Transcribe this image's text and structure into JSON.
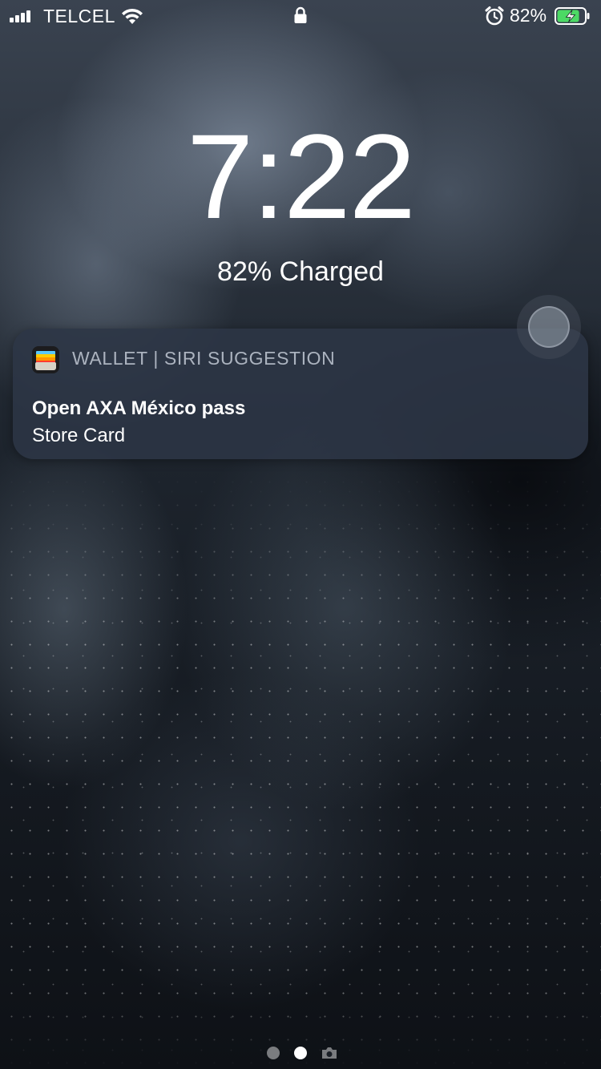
{
  "status_bar": {
    "carrier": "TELCEL",
    "battery_percent": "82%",
    "battery_level": 0.82,
    "charging": true,
    "icons": [
      "signal-icon",
      "wifi-icon",
      "lock-icon",
      "alarm-icon",
      "battery-icon"
    ]
  },
  "lock_screen": {
    "time": "7:22",
    "charge_status": "82% Charged"
  },
  "notification": {
    "app_icon": "wallet-icon",
    "header": "WALLET | SIRI SUGGESTION",
    "title": "Open AXA México pass",
    "body": "Store Card"
  },
  "page_indicator": {
    "pages": 3,
    "active_index": 1,
    "last_page_icon": "camera-icon"
  },
  "colors": {
    "notification_bg": "#2c3646",
    "battery_fill": "#4cd964",
    "text_primary": "#ffffff",
    "text_secondary": "#d7dee8"
  }
}
